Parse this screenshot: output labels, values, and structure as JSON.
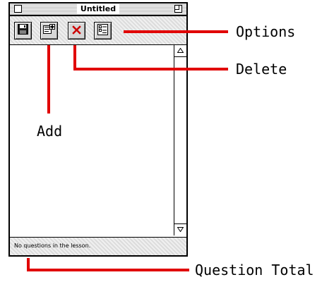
{
  "window": {
    "title": "Untitled",
    "toolbar": {
      "buttons": [
        {
          "icon": "save-icon"
        },
        {
          "icon": "add-question-icon"
        },
        {
          "icon": "delete-icon",
          "color": "#cc0000"
        },
        {
          "icon": "options-icon"
        }
      ]
    },
    "status_text": "No questions in the lesson."
  },
  "callouts": {
    "options": "Options",
    "delete": "Delete",
    "add": "Add",
    "question_total": "Question Total"
  },
  "colors": {
    "callout_line": "#e10000"
  }
}
